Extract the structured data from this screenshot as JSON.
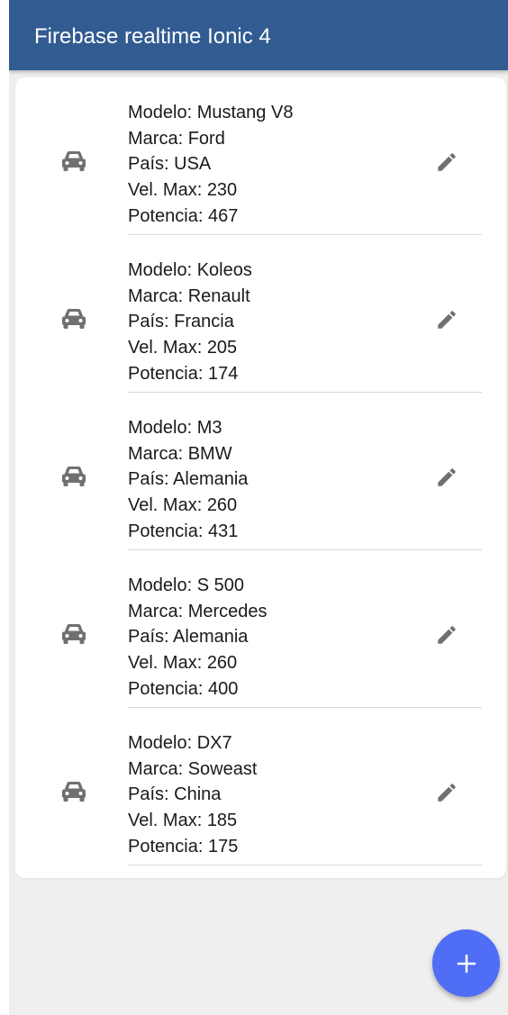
{
  "header": {
    "title": "Firebase realtime Ionic 4"
  },
  "labels": {
    "model": "Modelo: ",
    "brand": "Marca: ",
    "country": "País: ",
    "max_speed": "Vel. Max: ",
    "power": "Potencia: "
  },
  "cars": [
    {
      "model": "Mustang V8",
      "brand": "Ford",
      "country": "USA",
      "max_speed": "230",
      "power": "467"
    },
    {
      "model": "Koleos",
      "brand": "Renault",
      "country": "Francia",
      "max_speed": "205",
      "power": "174"
    },
    {
      "model": "M3",
      "brand": "BMW",
      "country": "Alemania",
      "max_speed": "260",
      "power": "431"
    },
    {
      "model": "S 500",
      "brand": "Mercedes",
      "country": "Alemania",
      "max_speed": "260",
      "power": "400"
    },
    {
      "model": "DX7",
      "brand": "Soweast",
      "country": "China",
      "max_speed": "185",
      "power": "175"
    }
  ],
  "icons": {
    "item_icon": "car-icon",
    "edit_icon": "pencil-icon",
    "fab_icon": "plus-icon"
  },
  "colors": {
    "toolbar": "#325b91",
    "fab": "#4f6df5",
    "icon": "#707070",
    "background": "#efefef"
  }
}
